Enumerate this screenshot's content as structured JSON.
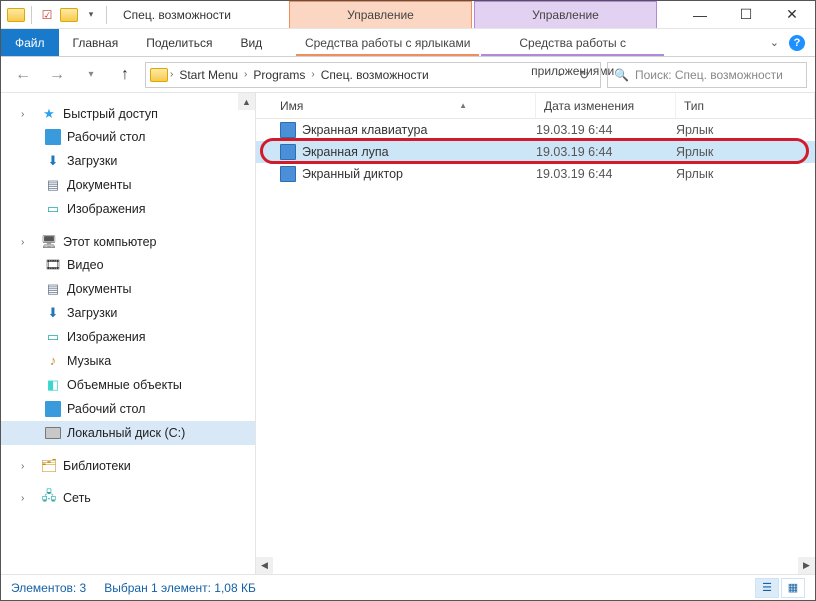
{
  "window": {
    "title": "Спец. возможности"
  },
  "title_context": {
    "manage": "Управление",
    "manage2": "Управление"
  },
  "ribbon": {
    "file": "Файл",
    "home": "Главная",
    "share": "Поделиться",
    "view": "Вид",
    "ctx1": "Средства работы с ярлыками",
    "ctx2": "Средства работы с приложениями"
  },
  "breadcrumb": {
    "seg1": "Start Menu",
    "seg2": "Programs",
    "seg3": "Спец. возможности"
  },
  "search": {
    "placeholder": "Поиск: Спец. возможности"
  },
  "nav": {
    "quick_access": "Быстрый доступ",
    "desktop": "Рабочий стол",
    "downloads": "Загрузки",
    "documents": "Документы",
    "pictures": "Изображения",
    "this_pc": "Этот компьютер",
    "videos": "Видео",
    "documents2": "Документы",
    "downloads2": "Загрузки",
    "pictures2": "Изображения",
    "music": "Музыка",
    "objects3d": "Объемные объекты",
    "desktop2": "Рабочий стол",
    "local_disk": "Локальный диск (C:)",
    "libraries": "Библиотеки",
    "network": "Сеть"
  },
  "columns": {
    "name": "Имя",
    "date": "Дата изменения",
    "type": "Тип"
  },
  "files": [
    {
      "name": "Экранная клавиатура",
      "date": "19.03.19 6:44",
      "type": "Ярлык",
      "selected": false
    },
    {
      "name": "Экранная лупа",
      "date": "19.03.19 6:44",
      "type": "Ярлык",
      "selected": true
    },
    {
      "name": "Экранный диктор",
      "date": "19.03.19 6:44",
      "type": "Ярлык",
      "selected": false
    }
  ],
  "status": {
    "count": "Элементов: 3",
    "selection": "Выбран 1 элемент: 1,08 КБ"
  }
}
